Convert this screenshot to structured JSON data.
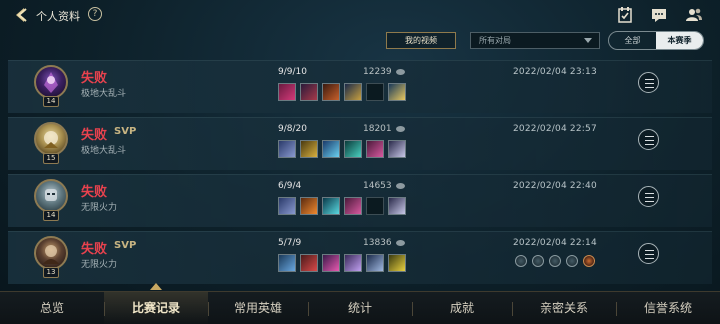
{
  "header": {
    "title": "个人资料",
    "help": "?"
  },
  "filters": {
    "my_videos": "我的视频",
    "match_type": "所有对局",
    "seg_all": "全部",
    "seg_season": "本赛季"
  },
  "matches": [
    {
      "result": "失败",
      "svp": "",
      "mode": "极地大乱斗",
      "level": "14",
      "kda": "9/9/10",
      "gold": "12239",
      "time": "2022/02/04 23:13",
      "has_badges": false
    },
    {
      "result": "失败",
      "svp": "SVP",
      "mode": "极地大乱斗",
      "level": "15",
      "kda": "9/8/20",
      "gold": "18201",
      "time": "2022/02/04 22:57",
      "has_badges": false
    },
    {
      "result": "失败",
      "svp": "",
      "mode": "无限火力",
      "level": "14",
      "kda": "6/9/4",
      "gold": "14653",
      "time": "2022/02/04 22:40",
      "has_badges": false
    },
    {
      "result": "失败",
      "svp": "SVP",
      "mode": "无限火力",
      "level": "13",
      "kda": "5/7/9",
      "gold": "13836",
      "time": "2022/02/04 22:14",
      "has_badges": true
    }
  ],
  "nav": {
    "overview": "总览",
    "match_history": "比赛记录",
    "heroes": "常用英雄",
    "stats": "统计",
    "achievements": "成就",
    "relations": "亲密关系",
    "honor": "信誉系统"
  },
  "colors": {
    "defeat": "#e8424e",
    "svp": "#c7b482",
    "accent_gold": "#c8a862"
  },
  "icons": [
    "back-arrow-icon",
    "help-icon",
    "calendar-check-icon",
    "chat-icon",
    "friends-icon",
    "gold-coin-icon",
    "list-detail-icon",
    "rune-badge-icon"
  ]
}
